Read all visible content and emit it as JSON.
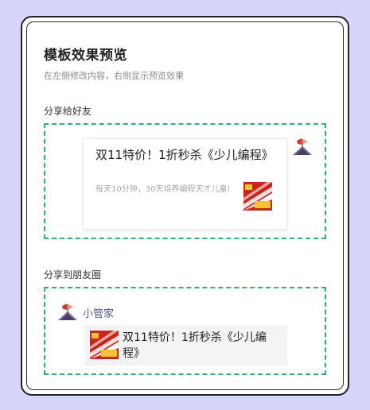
{
  "header": {
    "title": "模板效果预览",
    "subtitle": "在左侧修改内容，右侧显示预览效果"
  },
  "friend_share": {
    "section_label": "分享给好友",
    "card_title": "双11特价！1折秒杀《少儿编程》",
    "card_description": "每天10分钟，30天培养编程天才儿童!",
    "avatar_icon": "avatar-icon",
    "thumbnail_icon": "promo-thumbnail-image"
  },
  "moments_share": {
    "section_label": "分享到朋友圈",
    "username": "小管家",
    "link_title": "双11特价！1折秒杀《少儿编程》",
    "avatar_icon": "avatar-icon",
    "thumbnail_icon": "promo-thumbnail-image"
  },
  "colors": {
    "page_background": "#d6d6fb",
    "dashed_border": "#2fb36a",
    "username": "#4e5b8e",
    "subtitle": "#8a8a8a"
  }
}
